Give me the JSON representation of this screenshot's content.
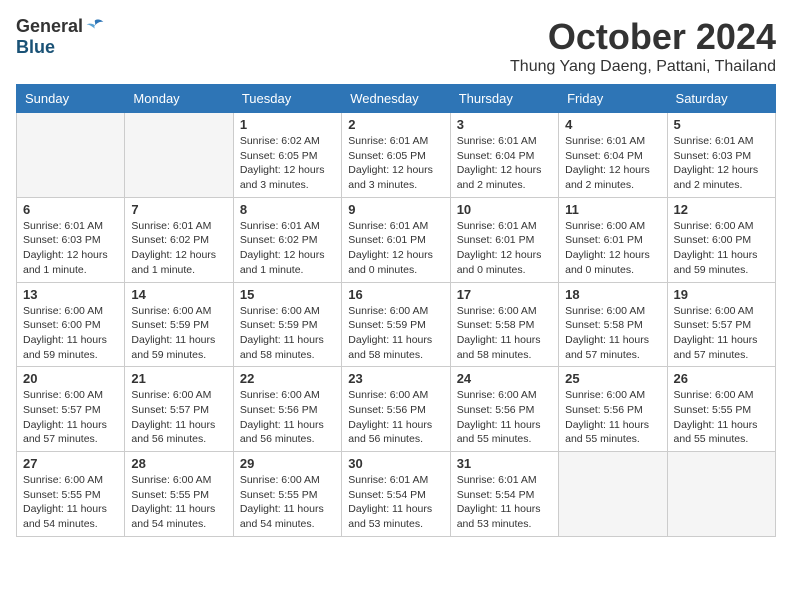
{
  "header": {
    "logo_general": "General",
    "logo_blue": "Blue",
    "month_title": "October 2024",
    "subtitle": "Thung Yang Daeng, Pattani, Thailand"
  },
  "weekdays": [
    "Sunday",
    "Monday",
    "Tuesday",
    "Wednesday",
    "Thursday",
    "Friday",
    "Saturday"
  ],
  "weeks": [
    [
      {
        "day": "",
        "info": ""
      },
      {
        "day": "",
        "info": ""
      },
      {
        "day": "1",
        "info": "Sunrise: 6:02 AM\nSunset: 6:05 PM\nDaylight: 12 hours\nand 3 minutes."
      },
      {
        "day": "2",
        "info": "Sunrise: 6:01 AM\nSunset: 6:05 PM\nDaylight: 12 hours\nand 3 minutes."
      },
      {
        "day": "3",
        "info": "Sunrise: 6:01 AM\nSunset: 6:04 PM\nDaylight: 12 hours\nand 2 minutes."
      },
      {
        "day": "4",
        "info": "Sunrise: 6:01 AM\nSunset: 6:04 PM\nDaylight: 12 hours\nand 2 minutes."
      },
      {
        "day": "5",
        "info": "Sunrise: 6:01 AM\nSunset: 6:03 PM\nDaylight: 12 hours\nand 2 minutes."
      }
    ],
    [
      {
        "day": "6",
        "info": "Sunrise: 6:01 AM\nSunset: 6:03 PM\nDaylight: 12 hours\nand 1 minute."
      },
      {
        "day": "7",
        "info": "Sunrise: 6:01 AM\nSunset: 6:02 PM\nDaylight: 12 hours\nand 1 minute."
      },
      {
        "day": "8",
        "info": "Sunrise: 6:01 AM\nSunset: 6:02 PM\nDaylight: 12 hours\nand 1 minute."
      },
      {
        "day": "9",
        "info": "Sunrise: 6:01 AM\nSunset: 6:01 PM\nDaylight: 12 hours\nand 0 minutes."
      },
      {
        "day": "10",
        "info": "Sunrise: 6:01 AM\nSunset: 6:01 PM\nDaylight: 12 hours\nand 0 minutes."
      },
      {
        "day": "11",
        "info": "Sunrise: 6:00 AM\nSunset: 6:01 PM\nDaylight: 12 hours\nand 0 minutes."
      },
      {
        "day": "12",
        "info": "Sunrise: 6:00 AM\nSunset: 6:00 PM\nDaylight: 11 hours\nand 59 minutes."
      }
    ],
    [
      {
        "day": "13",
        "info": "Sunrise: 6:00 AM\nSunset: 6:00 PM\nDaylight: 11 hours\nand 59 minutes."
      },
      {
        "day": "14",
        "info": "Sunrise: 6:00 AM\nSunset: 5:59 PM\nDaylight: 11 hours\nand 59 minutes."
      },
      {
        "day": "15",
        "info": "Sunrise: 6:00 AM\nSunset: 5:59 PM\nDaylight: 11 hours\nand 58 minutes."
      },
      {
        "day": "16",
        "info": "Sunrise: 6:00 AM\nSunset: 5:59 PM\nDaylight: 11 hours\nand 58 minutes."
      },
      {
        "day": "17",
        "info": "Sunrise: 6:00 AM\nSunset: 5:58 PM\nDaylight: 11 hours\nand 58 minutes."
      },
      {
        "day": "18",
        "info": "Sunrise: 6:00 AM\nSunset: 5:58 PM\nDaylight: 11 hours\nand 57 minutes."
      },
      {
        "day": "19",
        "info": "Sunrise: 6:00 AM\nSunset: 5:57 PM\nDaylight: 11 hours\nand 57 minutes."
      }
    ],
    [
      {
        "day": "20",
        "info": "Sunrise: 6:00 AM\nSunset: 5:57 PM\nDaylight: 11 hours\nand 57 minutes."
      },
      {
        "day": "21",
        "info": "Sunrise: 6:00 AM\nSunset: 5:57 PM\nDaylight: 11 hours\nand 56 minutes."
      },
      {
        "day": "22",
        "info": "Sunrise: 6:00 AM\nSunset: 5:56 PM\nDaylight: 11 hours\nand 56 minutes."
      },
      {
        "day": "23",
        "info": "Sunrise: 6:00 AM\nSunset: 5:56 PM\nDaylight: 11 hours\nand 56 minutes."
      },
      {
        "day": "24",
        "info": "Sunrise: 6:00 AM\nSunset: 5:56 PM\nDaylight: 11 hours\nand 55 minutes."
      },
      {
        "day": "25",
        "info": "Sunrise: 6:00 AM\nSunset: 5:56 PM\nDaylight: 11 hours\nand 55 minutes."
      },
      {
        "day": "26",
        "info": "Sunrise: 6:00 AM\nSunset: 5:55 PM\nDaylight: 11 hours\nand 55 minutes."
      }
    ],
    [
      {
        "day": "27",
        "info": "Sunrise: 6:00 AM\nSunset: 5:55 PM\nDaylight: 11 hours\nand 54 minutes."
      },
      {
        "day": "28",
        "info": "Sunrise: 6:00 AM\nSunset: 5:55 PM\nDaylight: 11 hours\nand 54 minutes."
      },
      {
        "day": "29",
        "info": "Sunrise: 6:00 AM\nSunset: 5:55 PM\nDaylight: 11 hours\nand 54 minutes."
      },
      {
        "day": "30",
        "info": "Sunrise: 6:01 AM\nSunset: 5:54 PM\nDaylight: 11 hours\nand 53 minutes."
      },
      {
        "day": "31",
        "info": "Sunrise: 6:01 AM\nSunset: 5:54 PM\nDaylight: 11 hours\nand 53 minutes."
      },
      {
        "day": "",
        "info": ""
      },
      {
        "day": "",
        "info": ""
      }
    ]
  ]
}
